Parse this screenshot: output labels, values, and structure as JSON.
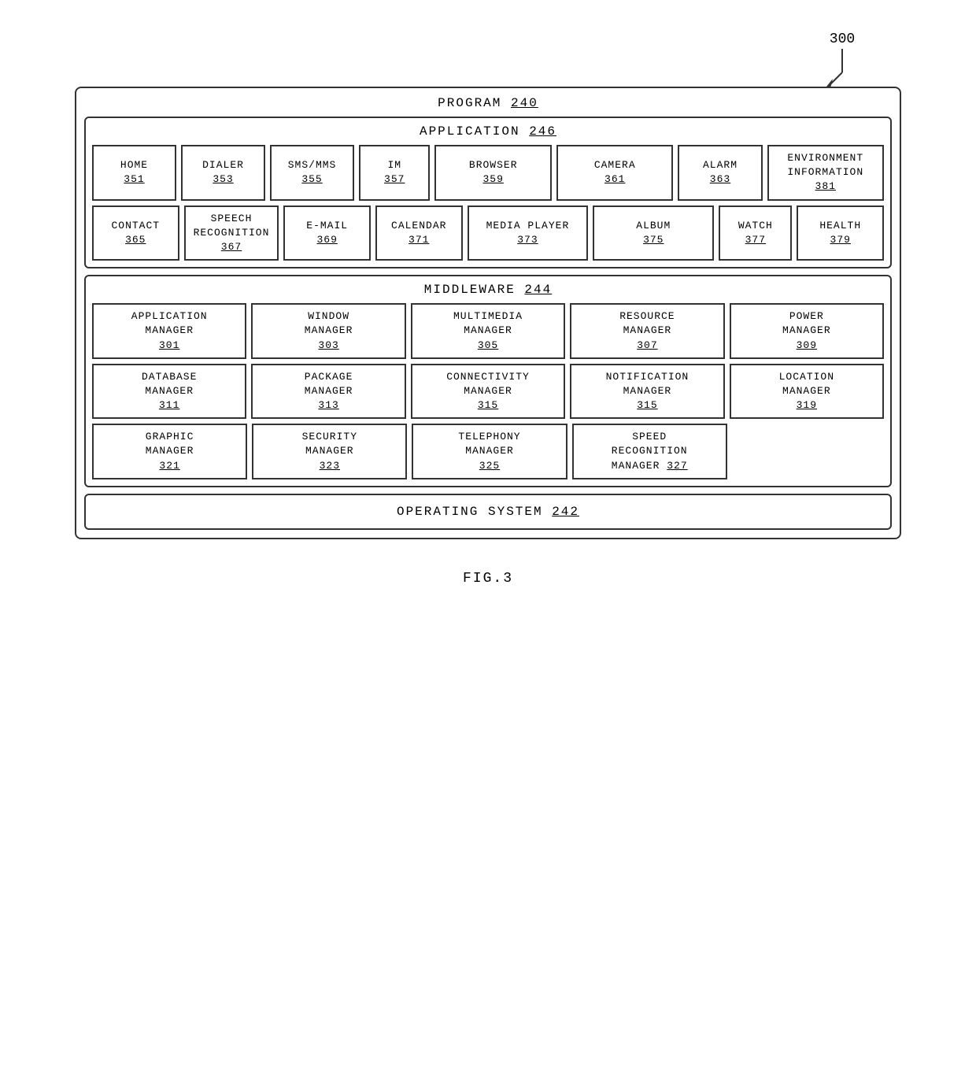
{
  "diagram": {
    "ref_number": "300",
    "program_label": "PROGRAM",
    "program_num": "240",
    "application_label": "APPLICATION",
    "application_num": "246",
    "middleware_label": "MIDDLEWARE",
    "middleware_num": "244",
    "os_label": "OPERATING SYSTEM",
    "os_num": "242",
    "app_row1": [
      {
        "line1": "HOME",
        "num": "351"
      },
      {
        "line1": "DIALER",
        "num": "353"
      },
      {
        "line1": "SMS/MMS",
        "num": "355"
      },
      {
        "line1": "IM",
        "num": "357"
      },
      {
        "line1": "BROWSER",
        "num": "359"
      },
      {
        "line1": "CAMERA",
        "num": "361"
      },
      {
        "line1": "ALARM",
        "num": "363"
      },
      {
        "line1": "ENVIRONMENT",
        "line2": "INFORMATION",
        "num": "381"
      }
    ],
    "app_row2": [
      {
        "line1": "CONTACT",
        "num": "365"
      },
      {
        "line1": "SPEECH",
        "line2": "RECOGNITION",
        "num": "367"
      },
      {
        "line1": "E-MAIL",
        "num": "369"
      },
      {
        "line1": "CALENDAR",
        "num": "371"
      },
      {
        "line1": "MEDIA PLAYER",
        "num": "373"
      },
      {
        "line1": "ALBUM",
        "num": "375"
      },
      {
        "line1": "WATCH",
        "num": "377"
      },
      {
        "line1": "HEALTH",
        "num": "379"
      }
    ],
    "mw_row1": [
      {
        "line1": "APPLICATION",
        "line2": "MANAGER",
        "num": "301"
      },
      {
        "line1": "WINDOW",
        "line2": "MANAGER",
        "num": "303"
      },
      {
        "line1": "MULTIMEDIA",
        "line2": "MANAGER",
        "num": "305"
      },
      {
        "line1": "RESOURCE",
        "line2": "MANAGER",
        "num": "307"
      },
      {
        "line1": "POWER",
        "line2": "MANAGER",
        "num": "309"
      }
    ],
    "mw_row2": [
      {
        "line1": "DATABASE",
        "line2": "MANAGER",
        "num": "311"
      },
      {
        "line1": "PACKAGE",
        "line2": "MANAGER",
        "num": "313"
      },
      {
        "line1": "CONNECTIVITY",
        "line2": "MANAGER",
        "num": "315"
      },
      {
        "line1": "NOTIFICATION",
        "line2": "MANAGER",
        "num": "315"
      },
      {
        "line1": "LOCATION",
        "line2": "MANAGER",
        "num": "319"
      }
    ],
    "mw_row3": [
      {
        "line1": "GRAPHIC",
        "line2": "MANAGER",
        "num": "321"
      },
      {
        "line1": "SECURITY",
        "line2": "MANAGER",
        "num": "323"
      },
      {
        "line1": "TELEPHONY",
        "line2": "MANAGER",
        "num": "325"
      },
      {
        "line1": "SPEED",
        "line2": "RECOGNITION",
        "line3": "MANAGER",
        "num": "327"
      },
      {
        "empty": true
      }
    ],
    "fig_label": "FIG.3"
  }
}
